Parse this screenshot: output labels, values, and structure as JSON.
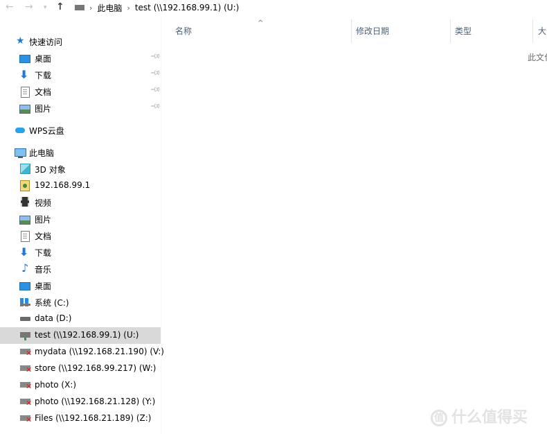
{
  "address_bar": {
    "crumbs": [
      "此电脑",
      "test (\\\\192.168.99.1) (U:)"
    ]
  },
  "columns": [
    {
      "label": "名称"
    },
    {
      "label": "修改日期"
    },
    {
      "label": "类型"
    },
    {
      "label": "大"
    }
  ],
  "empty_text": "此文化",
  "nav": {
    "quick_access": {
      "label": "快速访问",
      "items": [
        "桌面",
        "下载",
        "文档",
        "图片"
      ]
    },
    "wps": "WPS云盘",
    "this_pc": {
      "label": "此电脑",
      "items": [
        "3D 对象",
        "192.168.99.1",
        "视频",
        "图片",
        "文档",
        "下载",
        "音乐",
        "桌面",
        "系统 (C:)",
        "data (D:)",
        "test (\\\\192.168.99.1) (U:)",
        "mydata (\\\\192.168.21.190) (V:)",
        "store (\\\\192.168.99.217) (W:)",
        "photo  (X:)",
        "photo (\\\\192.168.21.128) (Y:)",
        "Files (\\\\192.168.21.189) (Z:)"
      ]
    }
  },
  "watermark": "什么值得买",
  "watermark_glyph": "值",
  "colors": {
    "selected_row": "#d9d9d9",
    "header_text": "#4c607a",
    "accent": "#1f7bd8"
  }
}
